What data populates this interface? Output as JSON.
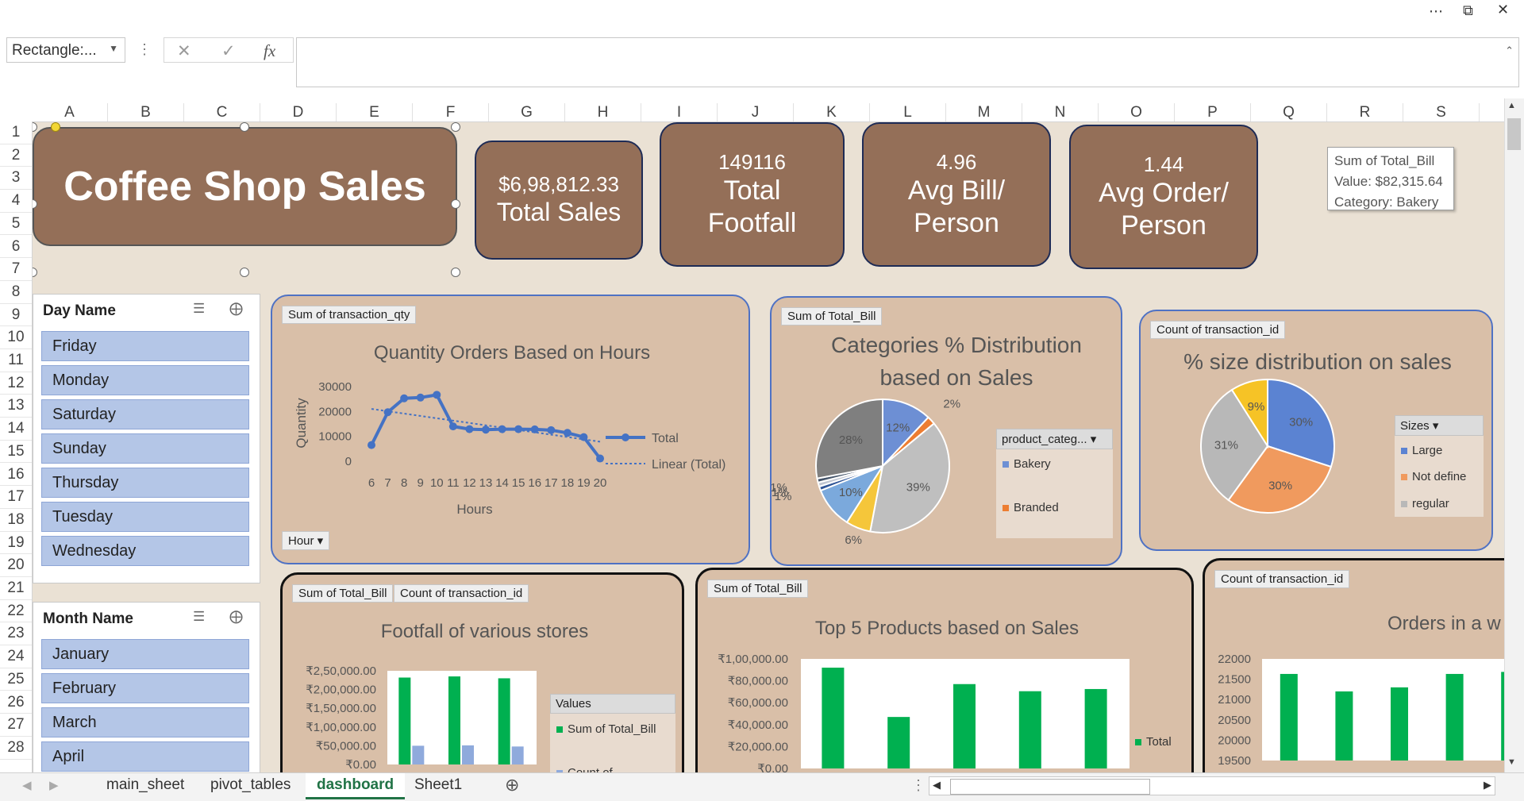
{
  "window": {
    "more_icon": "more-dots",
    "restore_icon": "restore",
    "close_icon": "close"
  },
  "formula_bar": {
    "name_box": "Rectangle:...",
    "fx_label": "fx",
    "cancel_glyph": "✕",
    "enter_glyph": "✓",
    "formula_value": ""
  },
  "columns": [
    "A",
    "B",
    "C",
    "D",
    "E",
    "F",
    "G",
    "H",
    "I",
    "J",
    "K",
    "L",
    "M",
    "N",
    "O",
    "P",
    "Q",
    "R",
    "S"
  ],
  "rows": [
    "1",
    "2",
    "3",
    "4",
    "5",
    "6",
    "7",
    "8",
    "9",
    "10",
    "11",
    "12",
    "13",
    "14",
    "15",
    "16",
    "17",
    "18",
    "19",
    "20",
    "21",
    "22",
    "23",
    "24",
    "25",
    "26",
    "27",
    "28"
  ],
  "dashboard": {
    "title": "Coffee Shop Sales",
    "kpis": [
      {
        "value": "$6,98,812.33",
        "label": "Total Sales"
      },
      {
        "value": "149116",
        "label": "Total",
        "label2": "Footfall"
      },
      {
        "value": "4.96",
        "label": "Avg Bill/",
        "label2": "Person"
      },
      {
        "value": "1.44",
        "label": "Avg Order/",
        "label2": "Person"
      }
    ]
  },
  "tooltip": {
    "line1": "Sum of Total_Bill",
    "line2": "Value:  $82,315.64",
    "line3": "Category: Bakery"
  },
  "slicers": {
    "day": {
      "title": "Day Name",
      "items": [
        "Friday",
        "Monday",
        "Saturday",
        "Sunday",
        "Thursday",
        "Tuesday",
        "Wednesday"
      ]
    },
    "month": {
      "title": "Month Name",
      "items": [
        "January",
        "February",
        "March",
        "April"
      ]
    }
  },
  "charts": {
    "quantity": {
      "field": "Sum of transaction_qty",
      "axis_button": "Hour",
      "title": "Quantity Orders Based on Hours",
      "xlabel": "Hours",
      "ylabel": "Quantity",
      "legend_total": "Total",
      "legend_trend": "Linear (Total)"
    },
    "categories": {
      "field": "Sum of Total_Bill",
      "title1": "Categories % Distribution",
      "title2": "based on Sales",
      "legend_head": "product_categ...",
      "legend": [
        "Bakery",
        "Branded"
      ]
    },
    "sizes": {
      "field": "Count of transaction_id",
      "title": "% size distribution on sales",
      "legend_head": "Sizes",
      "legend": [
        "Large",
        "Not define",
        "regular"
      ]
    },
    "stores": {
      "field1": "Sum of Total_Bill",
      "field2": "Count of transaction_id",
      "title": "Footfall of various stores",
      "legend_head": "Values",
      "legend": [
        "Sum of Total_Bill",
        "Count of"
      ]
    },
    "products": {
      "field": "Sum of Total_Bill",
      "title": "Top 5 Products based on Sales",
      "legend": "Total"
    },
    "week": {
      "field": "Count of transaction_id",
      "title": "Orders in a w"
    }
  },
  "chart_data": [
    {
      "type": "line",
      "title": "Quantity Orders Based on Hours",
      "xlabel": "Hours",
      "ylabel": "Quantity",
      "categories": [
        "6",
        "7",
        "8",
        "9",
        "10",
        "11",
        "12",
        "13",
        "14",
        "15",
        "16",
        "17",
        "18",
        "19",
        "20"
      ],
      "series": [
        {
          "name": "Total",
          "values": [
            6500,
            19700,
            25300,
            25600,
            26700,
            14000,
            12900,
            12700,
            12900,
            12900,
            12800,
            12500,
            11400,
            9700,
            1100
          ]
        }
      ],
      "trendline": "Linear (Total)",
      "ylim": [
        0,
        30000
      ],
      "yticks": [
        "0",
        "10000",
        "20000",
        "30000"
      ],
      "color": "#4472c4"
    },
    {
      "type": "pie",
      "title": "Categories % Distribution based on Sales",
      "slices": [
        {
          "label": "12%",
          "value": 12,
          "color": "#6d8fd4"
        },
        {
          "label": "2%",
          "value": 2,
          "color": "#ed7d31"
        },
        {
          "label": "39%",
          "value": 39,
          "color": "#bfbfbf"
        },
        {
          "label": "6%",
          "value": 6,
          "color": "#f5c63a"
        },
        {
          "label": "10%",
          "value": 10,
          "color": "#7ba9dc"
        },
        {
          "label": "1%",
          "value": 1,
          "color": "#2f5597"
        },
        {
          "label": "1%",
          "value": 1,
          "color": "#c0c6d2"
        },
        {
          "label": "1%",
          "value": 1,
          "color": "#44546a"
        },
        {
          "label": "28%",
          "value": 28,
          "color": "#7f7f7f"
        }
      ],
      "legend_title": "product_categ...",
      "legend": [
        "Bakery",
        "Branded"
      ]
    },
    {
      "type": "pie",
      "title": "% size distribution on sales",
      "slices": [
        {
          "label": "30%",
          "value": 30,
          "color": "#5b83d2"
        },
        {
          "label": "30%",
          "value": 30,
          "color": "#f09a5e"
        },
        {
          "label": "31%",
          "value": 31,
          "color": "#b8b8b8"
        },
        {
          "label": "9%",
          "value": 9,
          "color": "#f6c326"
        }
      ],
      "legend_title": "Sizes",
      "legend": [
        "Large",
        "Not define",
        "regular"
      ]
    },
    {
      "type": "bar",
      "title": "Footfall of various stores",
      "series": [
        {
          "name": "Sum of Total_Bill",
          "values": [
            232000,
            235000,
            230000
          ],
          "color": "#00b050"
        },
        {
          "name": "Count of",
          "values": [
            50000,
            51000,
            48000
          ],
          "color": "#8faadc"
        }
      ],
      "yticks": [
        "₹0.00",
        "₹50,000.00",
        "₹1,00,000.00",
        "₹1,50,000.00",
        "₹2,00,000.00",
        "₹2,50,000.00"
      ],
      "ylim": [
        0,
        250000
      ]
    },
    {
      "type": "bar",
      "title": "Top 5 Products based on Sales",
      "series": [
        {
          "name": "Total",
          "values": [
            92000,
            47000,
            77000,
            70500,
            72500
          ],
          "color": "#00b050"
        }
      ],
      "yticks": [
        "₹0.00",
        "₹20,000.00",
        "₹40,000.00",
        "₹60,000.00",
        "₹80,000.00",
        "₹1,00,000.00"
      ],
      "ylim": [
        0,
        100000
      ]
    },
    {
      "type": "bar",
      "title": "Orders in a w",
      "series": [
        {
          "values": [
            21630,
            21200,
            21300,
            21630,
            21680
          ],
          "color": "#00b050"
        }
      ],
      "yticks": [
        "19500",
        "20000",
        "20500",
        "21000",
        "21500",
        "22000"
      ],
      "ylim": [
        19500,
        22000
      ]
    }
  ],
  "tabs": [
    "main_sheet",
    "pivot_tables",
    "dashboard",
    "Sheet1"
  ],
  "active_tab": "dashboard",
  "colors": {
    "sheet_bg": "#eae1d4",
    "card": "#946f58",
    "panel": "#d9bfa8",
    "slicer_item": "#b4c6e7",
    "excel_green": "#217346"
  }
}
